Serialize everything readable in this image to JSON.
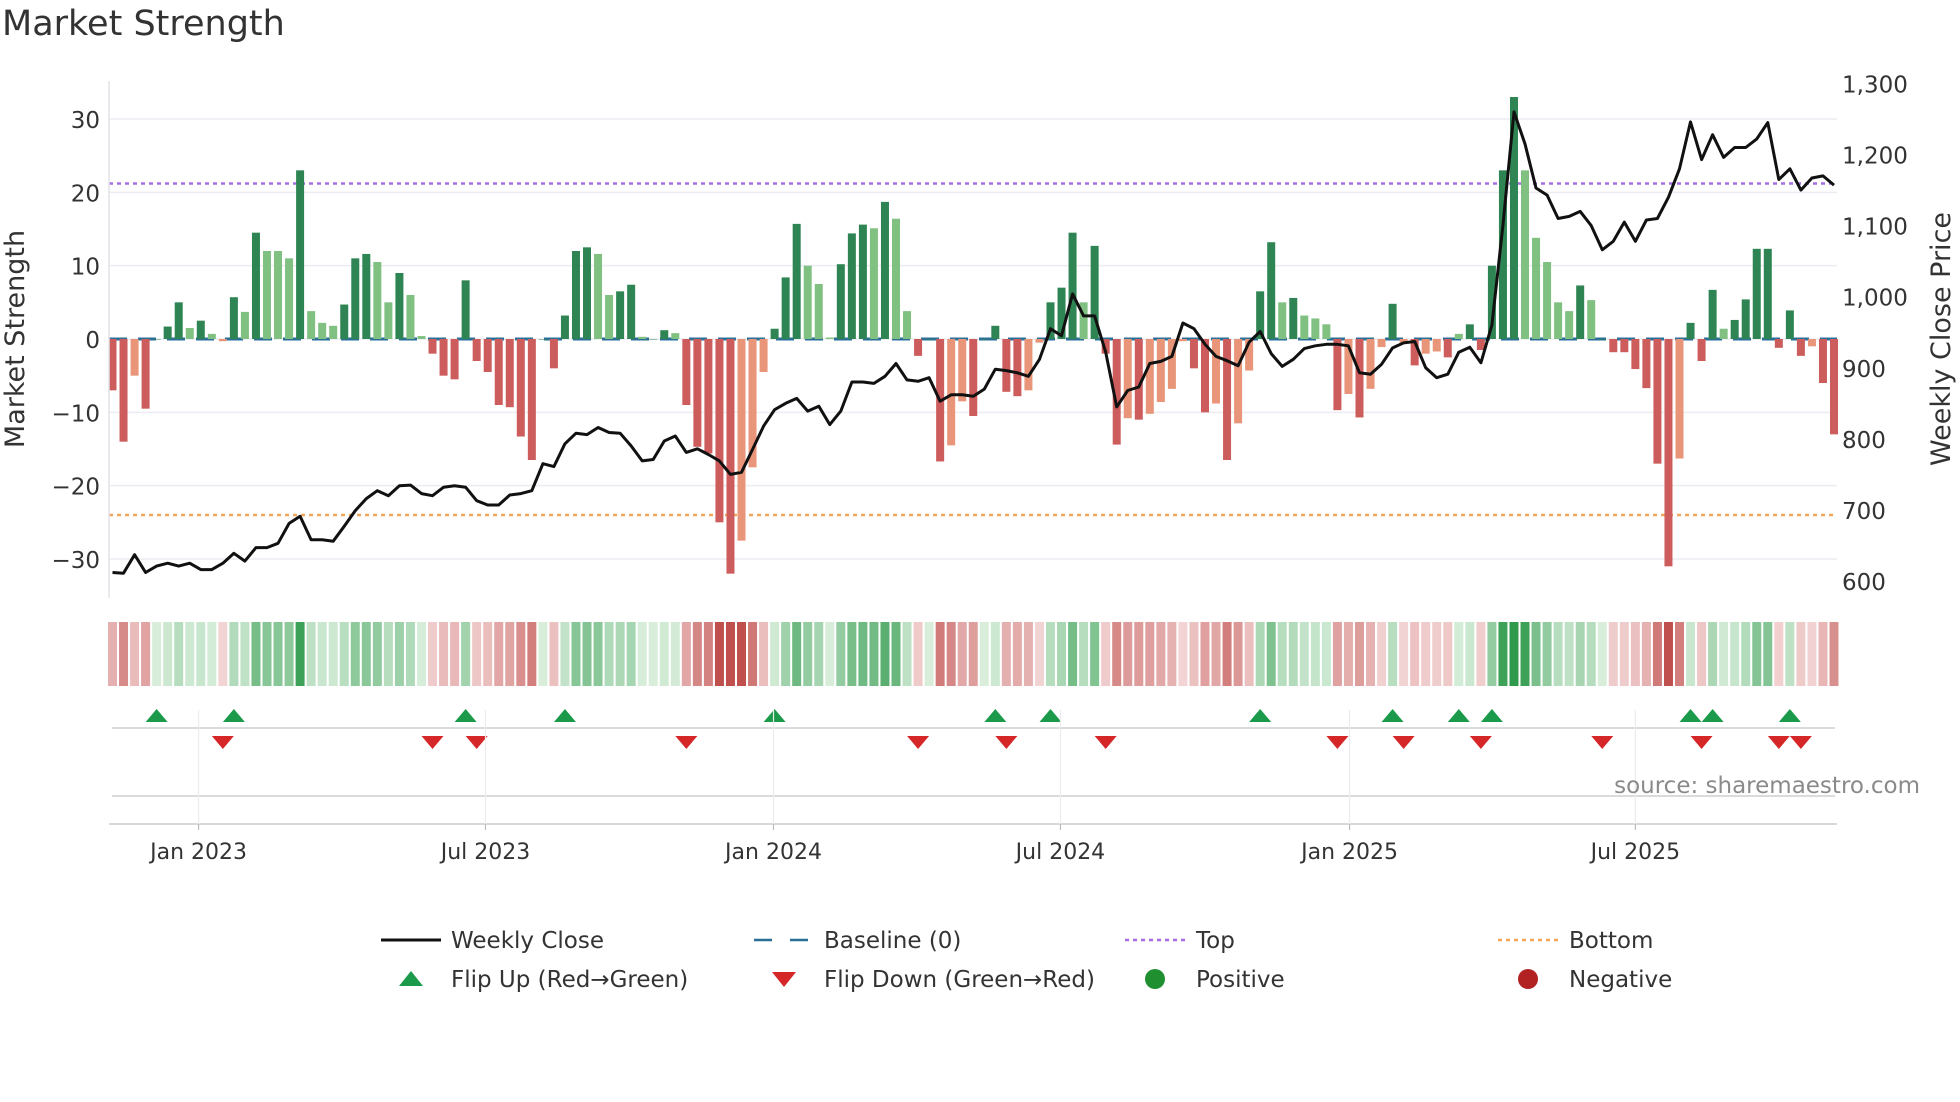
{
  "title": "Market Strength",
  "source": "source: sharemaestro.com",
  "colors": {
    "pos_dark": "#2e8553",
    "pos_light": "#80c080",
    "neg_dark": "#cd5c5c",
    "neg_light": "#e8957a",
    "top": "#a66ee0",
    "bottom": "#f0a65a",
    "baseline": "#2a6f97",
    "price": "#111111",
    "flip_up": "#1a9a4a",
    "flip_down": "#d62728"
  },
  "legend": [
    {
      "label": "Weekly Close",
      "kind": "line"
    },
    {
      "label": "Baseline (0)",
      "kind": "dash"
    },
    {
      "label": "Top",
      "kind": "dot-top"
    },
    {
      "label": "Bottom",
      "kind": "dot-bottom"
    },
    {
      "label": "Flip Up (Red→Green)",
      "kind": "tri-up"
    },
    {
      "label": "Flip Down (Green→Red)",
      "kind": "tri-down"
    },
    {
      "label": "Positive",
      "kind": "circle-pos"
    },
    {
      "label": "Negative",
      "kind": "circle-neg"
    }
  ],
  "chart_data": {
    "type": "bar",
    "title": "Market Strength",
    "ylabel": "Market Strength",
    "y2label": "Weekly Close Price",
    "ylim": [
      -36,
      36
    ],
    "y2lim": [
      590,
      1310
    ],
    "yticks": [
      -30,
      -20,
      -10,
      0,
      10,
      20,
      30
    ],
    "y2ticks": [
      600,
      700,
      800,
      900,
      1000,
      1100,
      1200,
      1300
    ],
    "y2tick_labels": [
      "600",
      "700",
      "800",
      "900",
      "1,000",
      "1,100",
      "1,200",
      "1,300"
    ],
    "top_level": 21.2,
    "bottom_level": -24,
    "baseline": 0,
    "xticks": [
      {
        "label": "Jan 2023",
        "week": 7.8
      },
      {
        "label": "Jul 2023",
        "week": 33.8
      },
      {
        "label": "Jan 2024",
        "week": 59.9
      },
      {
        "label": "Jul 2024",
        "week": 85.9
      },
      {
        "label": "Jan 2025",
        "week": 112.1
      },
      {
        "label": "Jul 2025",
        "week": 138.0
      }
    ],
    "strength": [
      -7,
      -14,
      -5,
      -9.5,
      0,
      1.7,
      5,
      1.5,
      2.5,
      0.7,
      -0.3,
      5.7,
      3.7,
      14.5,
      12,
      12,
      11,
      23,
      3.8,
      2.2,
      1.8,
      4.7,
      11,
      11.6,
      10.5,
      5,
      9,
      6,
      0.4,
      -2,
      -5,
      -5.5,
      8,
      -3,
      -4.5,
      -9,
      -9.3,
      -13.3,
      -16.5,
      0,
      -4,
      3.2,
      12,
      12.5,
      11.6,
      6,
      6.5,
      7.4,
      0.3,
      0,
      1.2,
      0.8,
      -9,
      -14.7,
      -15.6,
      -25,
      -32,
      -27.5,
      -17.5,
      -4.5,
      1.4,
      8.4,
      15.7,
      10,
      7.5,
      0.2,
      10.2,
      14.4,
      15.6,
      15.1,
      18.7,
      16.4,
      3.8,
      -2.3,
      0,
      -16.7,
      -14.5,
      -8.5,
      -10.5,
      0,
      1.8,
      -7.2,
      -7.8,
      -7,
      -0.5,
      5,
      7,
      14.5,
      5,
      12.7,
      -2,
      -14.4,
      -10.8,
      -11,
      -10.2,
      -8.6,
      -6.8,
      -0.3,
      -4,
      -10,
      -8.8,
      -16.5,
      -11.5,
      -4.3,
      6.5,
      13.2,
      5,
      5.6,
      3.2,
      2.8,
      2,
      -9.7,
      -7.5,
      -10.7,
      -6.8,
      -1.1,
      4.8,
      -0.5,
      -3.6,
      -2,
      -1.7,
      -2.5,
      0.7,
      2,
      -1.5,
      10,
      23,
      33,
      23,
      13.8,
      10.5,
      5,
      3.8,
      7.3,
      5.3,
      0,
      -1.8,
      -1.8,
      -4.1,
      -6.7,
      -17,
      -31,
      -16.3,
      2.2,
      -3,
      6.7,
      1.4,
      2.6,
      5.4,
      12.3,
      12.3,
      -1.2,
      3.9,
      -2.3,
      -1,
      -6,
      -13
    ],
    "shade": [
      "d",
      "d",
      "l",
      "d",
      "d",
      "d",
      "d",
      "l",
      "d",
      "l",
      "l",
      "d",
      "l",
      "d",
      "l",
      "l",
      "l",
      "d",
      "l",
      "l",
      "l",
      "d",
      "d",
      "d",
      "l",
      "l",
      "d",
      "l",
      "l",
      "d",
      "d",
      "d",
      "d",
      "d",
      "d",
      "d",
      "d",
      "d",
      "d",
      "d",
      "d",
      "d",
      "d",
      "d",
      "l",
      "l",
      "d",
      "d",
      "l",
      "d",
      "d",
      "l",
      "d",
      "d",
      "d",
      "d",
      "d",
      "l",
      "l",
      "l",
      "d",
      "d",
      "d",
      "l",
      "l",
      "l",
      "d",
      "d",
      "d",
      "l",
      "d",
      "l",
      "l",
      "d",
      "d",
      "d",
      "l",
      "l",
      "d",
      "d",
      "d",
      "d",
      "d",
      "l",
      "l",
      "d",
      "d",
      "d",
      "l",
      "d",
      "d",
      "d",
      "l",
      "d",
      "l",
      "l",
      "l",
      "l",
      "d",
      "d",
      "l",
      "d",
      "l",
      "l",
      "d",
      "d",
      "l",
      "d",
      "l",
      "l",
      "l",
      "d",
      "l",
      "d",
      "l",
      "l",
      "d",
      "l",
      "d",
      "l",
      "l",
      "d",
      "l",
      "d",
      "d",
      "d",
      "d",
      "d",
      "l",
      "l",
      "l",
      "l",
      "l",
      "d",
      "l",
      "d",
      "d",
      "d",
      "d",
      "d",
      "d",
      "d",
      "l",
      "d",
      "d",
      "d",
      "l",
      "d",
      "d",
      "d",
      "d",
      "d",
      "d",
      "d",
      "l",
      "d",
      "d"
    ],
    "weekly_close": [
      612,
      611,
      637,
      612,
      621,
      625,
      621,
      625,
      616,
      616,
      625,
      639,
      628,
      647,
      647,
      653,
      681,
      691,
      658,
      658,
      656,
      677,
      699,
      716,
      727,
      720,
      734,
      735,
      723,
      720,
      732,
      734,
      732,
      713,
      707,
      707,
      721,
      723,
      727,
      765,
      761,
      793,
      808,
      806,
      816,
      809,
      808,
      790,
      769,
      771,
      797,
      804,
      781,
      786,
      778,
      769,
      750,
      753,
      785,
      818,
      841,
      850,
      857,
      839,
      846,
      820,
      839,
      880,
      880,
      878,
      888,
      906,
      883,
      881,
      886,
      853,
      862,
      862,
      860,
      870,
      898,
      896,
      893,
      888,
      912,
      955,
      945,
      1004,
      973,
      973,
      922,
      845,
      868,
      873,
      906,
      909,
      916,
      963,
      955,
      933,
      916,
      910,
      903,
      936,
      951,
      920,
      902,
      912,
      927,
      931,
      933,
      933,
      931,
      893,
      891,
      905,
      928,
      935,
      937,
      900,
      886,
      891,
      922,
      929,
      907,
      960,
      1100,
      1260,
      1215,
      1153,
      1143,
      1110,
      1113,
      1120,
      1100,
      1066,
      1078,
      1105,
      1078,
      1108,
      1110,
      1140,
      1180,
      1246,
      1193,
      1228,
      1196,
      1210,
      1210,
      1222,
      1245,
      1165,
      1180,
      1150,
      1167,
      1170,
      1157
    ],
    "flip_up_weeks": [
      4,
      11,
      32,
      41,
      60,
      80,
      85,
      104,
      116,
      122,
      125,
      143,
      145,
      152
    ],
    "flip_down_weeks": [
      10,
      29,
      33,
      52,
      73,
      81,
      90,
      111,
      117,
      124,
      135,
      144,
      151,
      153
    ]
  }
}
